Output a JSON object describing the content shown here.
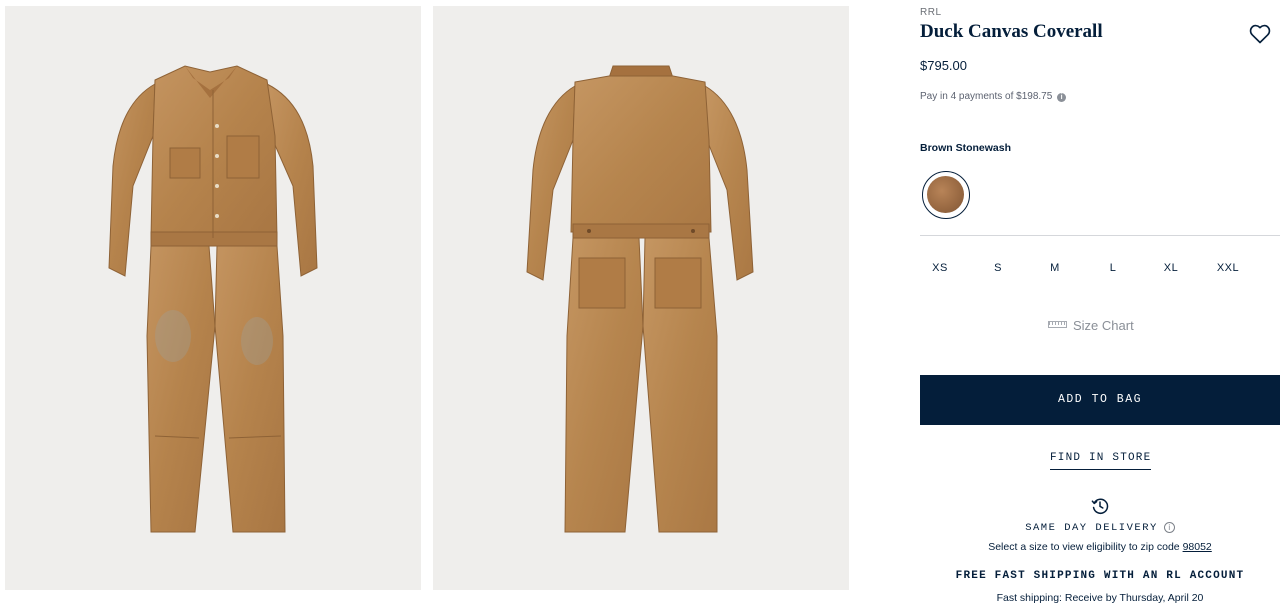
{
  "gallery": {
    "images": [
      {
        "view": "front"
      },
      {
        "view": "back"
      }
    ]
  },
  "product": {
    "brand": "RRL",
    "title": "Duck Canvas Coverall",
    "price": "$795.00",
    "installments_text": "Pay in 4 payments of $198.75",
    "color_label": "Brown Stonewash",
    "swatch_color": "#9a6a43",
    "sizes": [
      "XS",
      "S",
      "M",
      "L",
      "XL",
      "XXL"
    ],
    "size_chart_label": "Size Chart",
    "add_to_bag_label": "ADD TO BAG",
    "find_in_store_label": "FIND IN STORE"
  },
  "delivery": {
    "title": "SAME DAY DELIVERY",
    "info_glyph": "i",
    "zip_prefix": "Select a size to view eligibility to zip code",
    "zip_code": "98052",
    "free_shipping": "FREE FAST SHIPPING WITH AN RL ACCOUNT",
    "fast_shipping": "Fast shipping: Receive by Thursday, April 20"
  },
  "icons": {
    "wishlist": "heart-icon",
    "installment_info": "info-icon",
    "size_chart": "ruler-icon",
    "delivery": "clock-icon"
  },
  "colors": {
    "navy": "#041e3a",
    "canvas_brown": "#b8864f",
    "image_bg": "#efeeec"
  }
}
